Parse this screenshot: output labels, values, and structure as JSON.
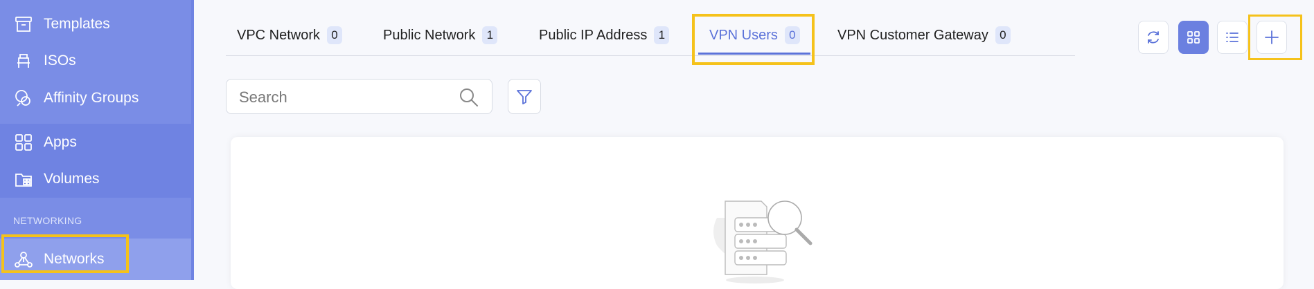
{
  "sidebar": {
    "items": [
      {
        "label": "Templates",
        "icon": "templates-icon"
      },
      {
        "label": "ISOs",
        "icon": "iso-icon"
      },
      {
        "label": "Affinity Groups",
        "icon": "affinity-groups-icon"
      },
      {
        "label": "Apps",
        "icon": "apps-icon"
      },
      {
        "label": "Volumes",
        "icon": "volumes-icon"
      }
    ],
    "section_label": "NETWORKING",
    "active_item": {
      "label": "Networks",
      "icon": "networks-icon"
    }
  },
  "tabs": [
    {
      "label": "VPC Network",
      "count": "0"
    },
    {
      "label": "Public Network",
      "count": "1"
    },
    {
      "label": "Public IP Address",
      "count": "1"
    },
    {
      "label": "VPN Users",
      "count": "0",
      "active": true
    },
    {
      "label": "VPN Customer Gateway",
      "count": "0"
    }
  ],
  "toolbar": {
    "buttons": [
      "refresh-icon",
      "grid-view-icon",
      "list-view-icon",
      "add-icon"
    ],
    "active": "grid-view-icon"
  },
  "search": {
    "placeholder": "Search",
    "value": ""
  },
  "colors": {
    "sidebar": "#7a8de6",
    "accent": "#5b72d9",
    "highlight": "#f5c21b",
    "badge": "#dfe6fa"
  }
}
